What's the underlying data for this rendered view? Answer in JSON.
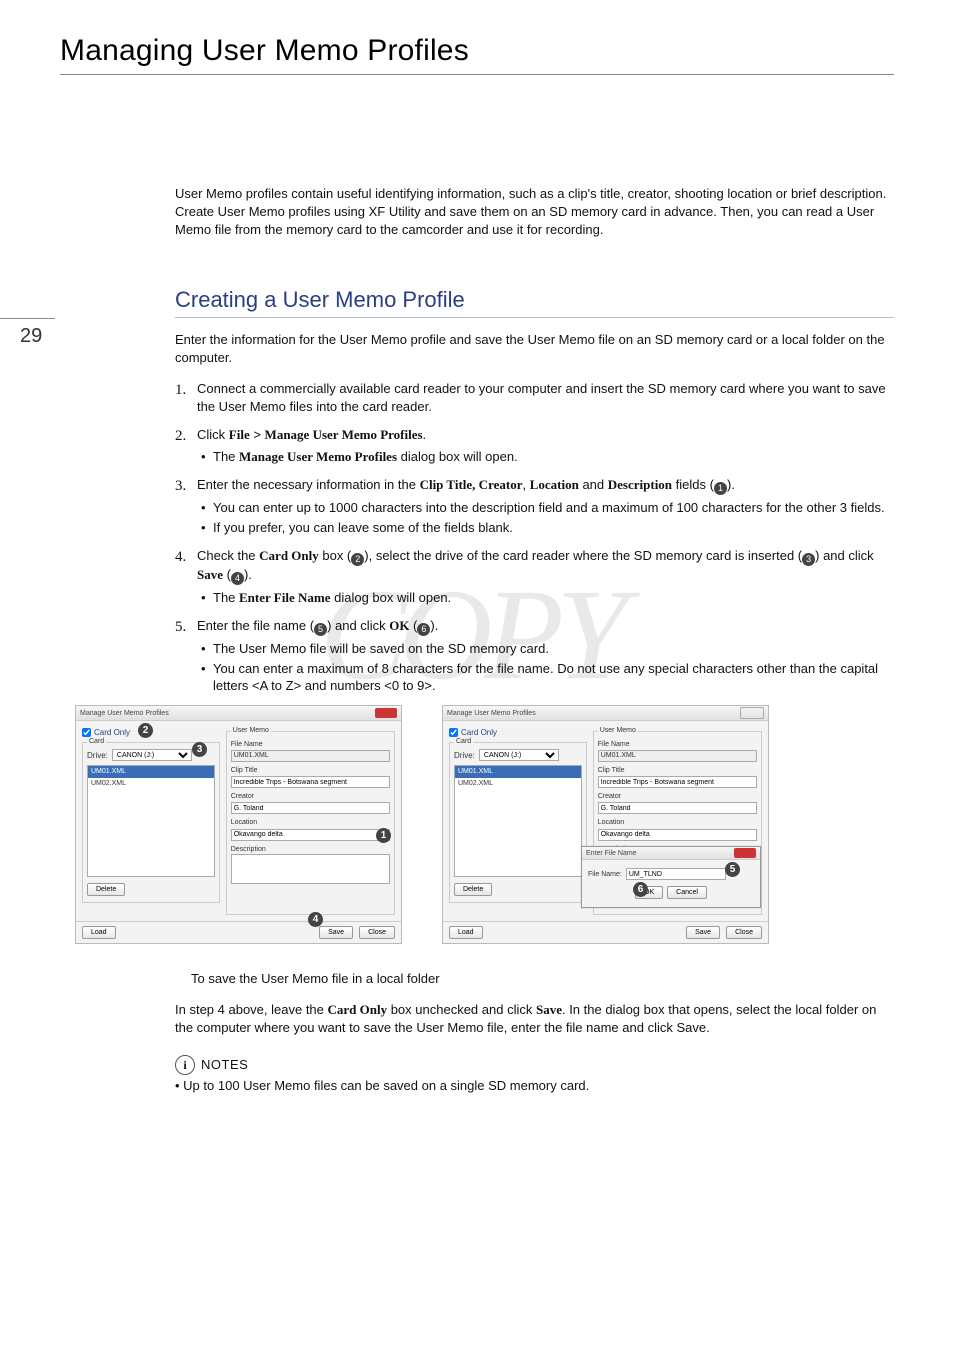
{
  "page_number": "29",
  "title": "Managing User Memo Profiles",
  "intro": "User Memo profiles contain useful identifying information, such as a clip's title, creator, shooting location or brief description. Create User Memo profiles using XF Utility and save them on an SD memory card in advance. Then, you can read a User Memo file from the memory card to the camcorder and use it for recording.",
  "section_title": "Creating a User Memo Profile",
  "section_intro": "Enter the information for the User Memo profile and save the User Memo file on an SD memory card or a local folder on the computer.",
  "steps": {
    "s1": "Connect a commercially available card reader to your computer and insert the SD memory card where you want to save the User Memo files into the card reader.",
    "s2_a": "Click ",
    "s2_b": "File",
    "s2_c": " > ",
    "s2_d": "Manage User Memo Profiles",
    "s2_e": ".",
    "s2_sub_a": "The ",
    "s2_sub_b": "Manage User Memo Profiles",
    "s2_sub_c": " dialog box will open.",
    "s3_a": "Enter the necessary information in the ",
    "s3_b": "Clip Title, Creator",
    "s3_c": ", ",
    "s3_d": "Location",
    "s3_e": " and ",
    "s3_f": "Description",
    "s3_g": " fields (",
    "s3_h": ").",
    "s3_sub1": "You can enter up to 1000 characters into the description field and a maximum of 100 characters for the other 3 fields.",
    "s3_sub2": "If you prefer, you can leave some of the fields blank.",
    "s4_a": "Check the ",
    "s4_b": "Card Only",
    "s4_c": " box (",
    "s4_d": "), select the drive of the card reader where the SD memory card is inserted (",
    "s4_e": ") and click ",
    "s4_f": "Save",
    "s4_g": " (",
    "s4_h": ").",
    "s4_sub_a": "The ",
    "s4_sub_b": "Enter File Name",
    "s4_sub_c": " dialog box will open.",
    "s5_a": "Enter the file name (",
    "s5_b": ") and click ",
    "s5_c": "OK",
    "s5_d": " (",
    "s5_e": ").",
    "s5_sub1": "The User Memo file will be saved on the SD memory card.",
    "s5_sub2": "You can enter a maximum of 8 characters for the file name. Do not use any special characters other than the capital letters <A to Z> and numbers <0 to 9>."
  },
  "markers": {
    "m1": "1",
    "m2": "2",
    "m3": "3",
    "m4": "4",
    "m5": "5",
    "m6": "6"
  },
  "win": {
    "title": "Manage User Memo Profiles",
    "card_only": "Card Only",
    "card_legend": "Card",
    "drive_label": "Drive:",
    "drive_value": "CANON (J:)",
    "file_sel": "UM01.XML",
    "file_item": "UM02.XML",
    "um_legend": "User Memo",
    "filename_label": "File Name",
    "filename_value": "UM01.XML",
    "cliptitle_label": "Clip Title",
    "cliptitle_value": "Incredible Trips - Botswana segment",
    "creator_label": "Creator",
    "creator_value": "G. Toland",
    "location_label": "Location",
    "location_value": "Okavango delta",
    "description_label": "Description",
    "delete": "Delete",
    "load": "Load",
    "save": "Save",
    "close": "Close"
  },
  "modal": {
    "title": "Enter File Name",
    "label": "File Name:",
    "value": "UM_TLND",
    "ok": "OK",
    "cancel": "Cancel"
  },
  "subhead": "To save the User Memo file in a local folder",
  "local_a": "In step 4 above, leave the ",
  "local_b": "Card Only",
  "local_c": " box unchecked and click ",
  "local_d": "Save",
  "local_e": ". In the dialog box that opens, select the local folder on the computer where you want to save the User Memo file, enter the file name and click Save.",
  "notes_label": "NOTES",
  "notes_item": "Up to 100 User Memo files can be saved on a single SD memory card.",
  "watermark": "COPY"
}
